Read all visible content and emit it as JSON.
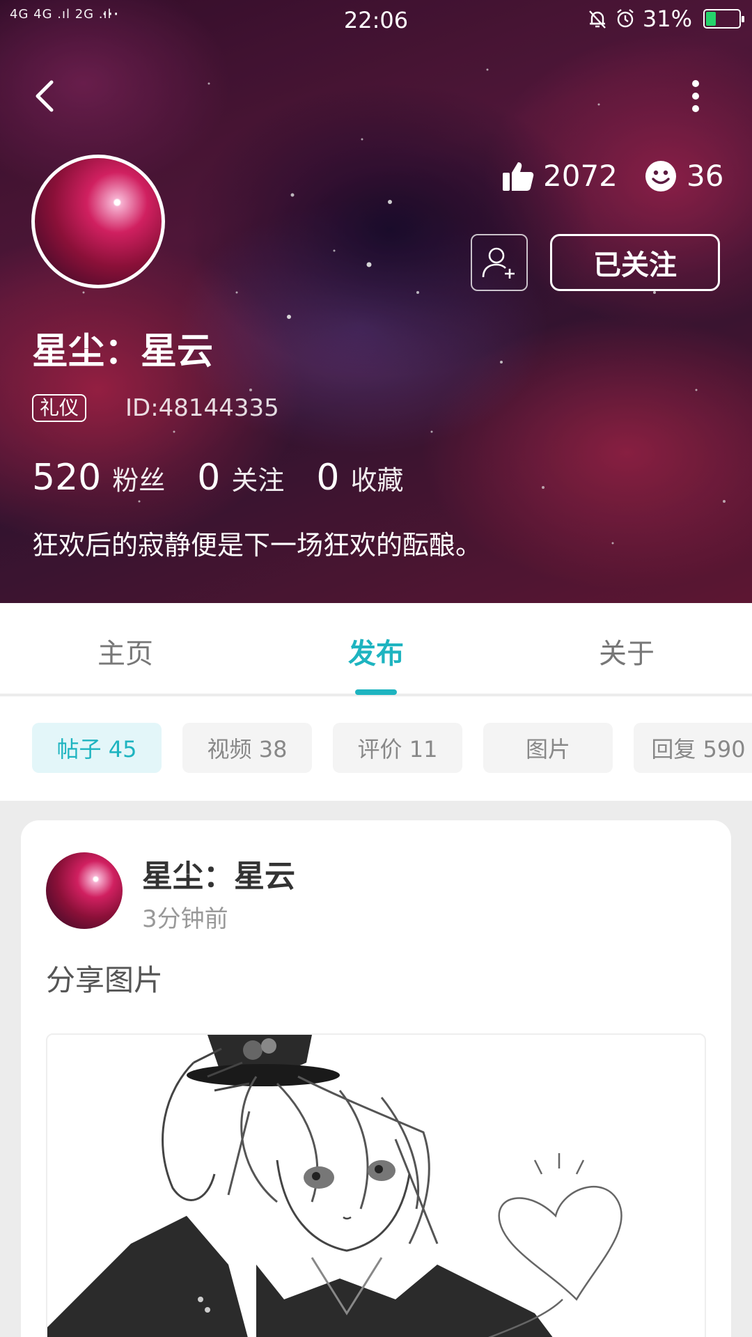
{
  "status_bar": {
    "signal": "4G 4G .ıl 2G .ıl",
    "dots": "···",
    "time": "22:06",
    "battery": "31%",
    "battery_level": 0.31
  },
  "profile": {
    "likes": "2072",
    "smiles": "36",
    "follow_label": "已关注",
    "name": "星尘：星云",
    "tag": "礼仪",
    "id": "ID:48144335",
    "stats": [
      {
        "value": "520",
        "label": "粉丝"
      },
      {
        "value": "0",
        "label": "关注"
      },
      {
        "value": "0",
        "label": "收藏"
      }
    ],
    "bio": "狂欢后的寂静便是下一场狂欢的酝酿。"
  },
  "tabs": [
    {
      "label": "主页"
    },
    {
      "label": "发布"
    },
    {
      "label": "关于"
    }
  ],
  "filters": [
    {
      "label": "帖子 45"
    },
    {
      "label": "视频 38"
    },
    {
      "label": "评价 11"
    },
    {
      "label": "图片"
    },
    {
      "label": "回复 590"
    }
  ],
  "post": {
    "author": "星尘：星云",
    "time": "3分钟前",
    "text": "分享图片"
  },
  "colors": {
    "accent": "#1eb4c0",
    "chip_active_bg": "#e3f6f9",
    "battery_green": "#25d36b"
  },
  "icons": {
    "back": "chevron-left",
    "more": "vertical-dots",
    "likes": "thumbs-up",
    "smiles": "smiley-face",
    "add_user": "person-plus"
  }
}
